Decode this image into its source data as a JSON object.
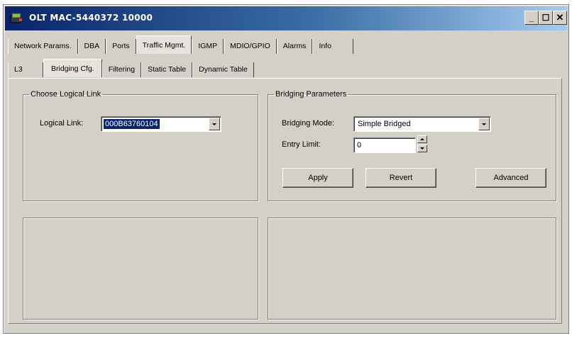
{
  "window": {
    "title": "OLT MAC-5440372 10000",
    "buttons": {
      "minimize": "_",
      "maximize": "☐",
      "close": "✕"
    }
  },
  "tabs_primary": [
    "Network Params.",
    "DBA",
    "Ports",
    "Traffic Mgmt.",
    "IGMP",
    "MDIO/GPIO",
    "Alarms",
    "Info"
  ],
  "tabs_primary_active": "Traffic Mgmt.",
  "tabs_secondary": [
    "L3",
    "Bridging Cfg.",
    "Filtering",
    "Static Table",
    "Dynamic Table"
  ],
  "tabs_secondary_active": "Bridging Cfg.",
  "logical_link": {
    "group_title": "Choose Logical Link",
    "label": "Logical Link:",
    "selected": "000B63760104"
  },
  "bridging": {
    "group_title": "Bridging Parameters",
    "mode_label": "Bridging Mode:",
    "mode_value": "Simple Bridged",
    "entry_limit_label": "Entry Limit:",
    "entry_limit_value": "0",
    "apply_label": "Apply",
    "revert_label": "Revert",
    "advanced_label": "Advanced"
  },
  "colors": {
    "face": "#d4d0c8",
    "title_start": "#0a246a",
    "title_end": "#a6caf0",
    "selection": "#0a246a"
  }
}
